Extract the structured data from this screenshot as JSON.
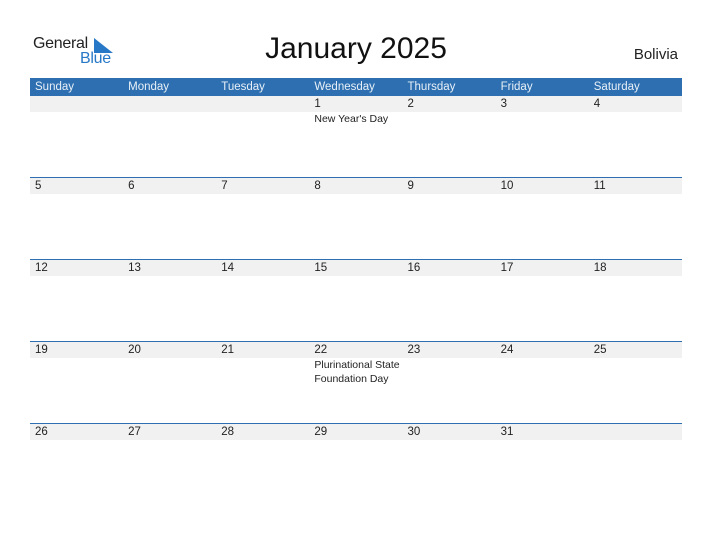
{
  "logo": {
    "line1": "General",
    "line2": "Blue"
  },
  "title": "January 2025",
  "country": "Bolivia",
  "colors": {
    "header_bg": "#2d6fb0",
    "row_bg": "#f1f1f1",
    "accent": "#2878c8"
  },
  "weekdays": [
    "Sunday",
    "Monday",
    "Tuesday",
    "Wednesday",
    "Thursday",
    "Friday",
    "Saturday"
  ],
  "weeks": [
    {
      "days": [
        "",
        "",
        "",
        "1",
        "2",
        "3",
        "4"
      ],
      "events": [
        "",
        "",
        "",
        "New Year's Day",
        "",
        "",
        ""
      ]
    },
    {
      "days": [
        "5",
        "6",
        "7",
        "8",
        "9",
        "10",
        "11"
      ],
      "events": [
        "",
        "",
        "",
        "",
        "",
        "",
        ""
      ]
    },
    {
      "days": [
        "12",
        "13",
        "14",
        "15",
        "16",
        "17",
        "18"
      ],
      "events": [
        "",
        "",
        "",
        "",
        "",
        "",
        ""
      ]
    },
    {
      "days": [
        "19",
        "20",
        "21",
        "22",
        "23",
        "24",
        "25"
      ],
      "events": [
        "",
        "",
        "",
        "Plurinational State Foundation Day",
        "",
        "",
        ""
      ]
    },
    {
      "days": [
        "26",
        "27",
        "28",
        "29",
        "30",
        "31",
        ""
      ],
      "events": [
        "",
        "",
        "",
        "",
        "",
        "",
        ""
      ]
    }
  ]
}
